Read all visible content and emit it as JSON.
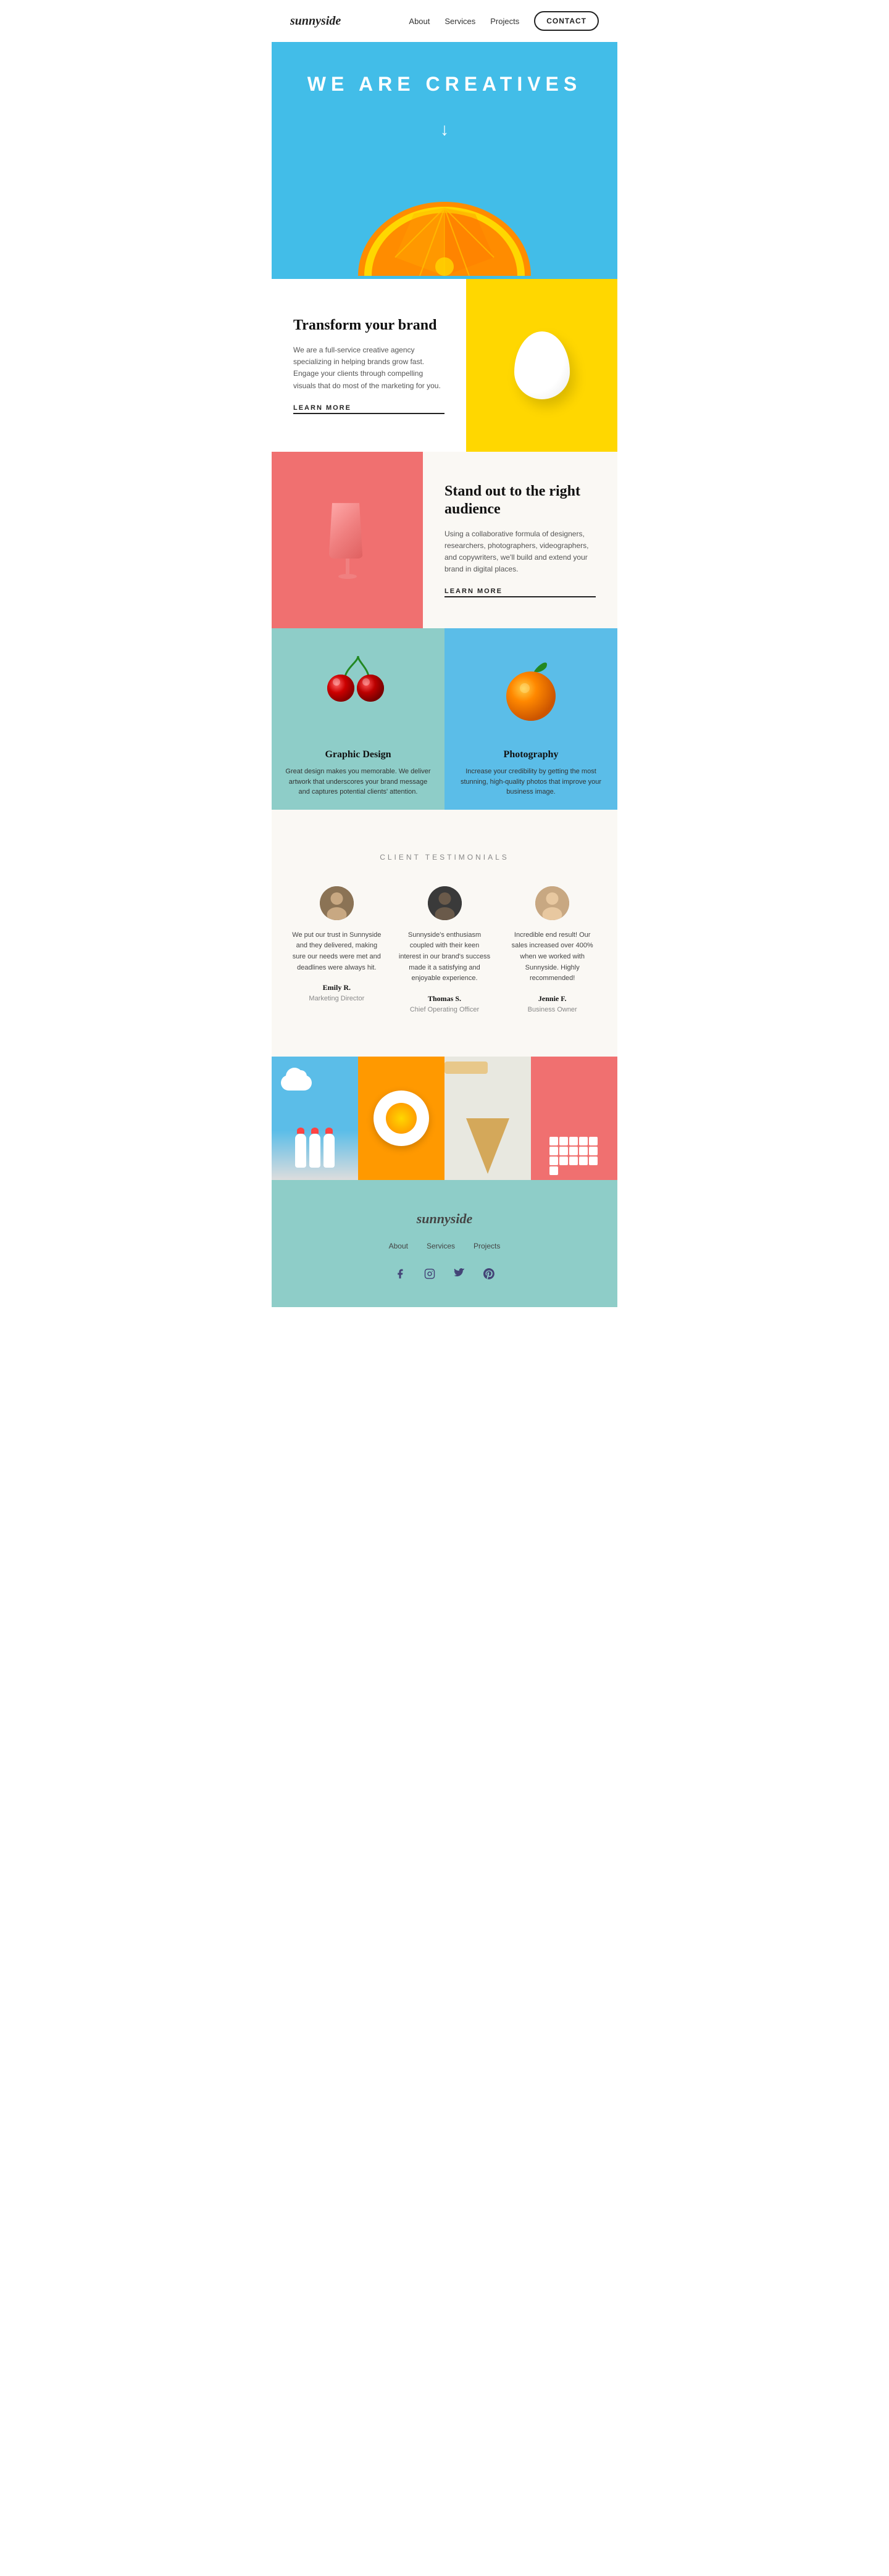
{
  "nav": {
    "logo": "sunnyside",
    "links": [
      {
        "label": "About",
        "href": "#about"
      },
      {
        "label": "Services",
        "href": "#services"
      },
      {
        "label": "Projects",
        "href": "#projects"
      }
    ],
    "contact_label": "CONTACT"
  },
  "hero": {
    "title": "WE ARE CREATIVES",
    "arrow": "↓"
  },
  "transform": {
    "heading": "Transform your brand",
    "body": "We are a full-service creative agency specializing in helping brands grow fast. Engage your clients through compelling visuals that do most of the marketing for you.",
    "cta": "LEARN MORE"
  },
  "standout": {
    "heading": "Stand out to the right audience",
    "body": "Using a collaborative formula of designers, researchers, photographers, videographers, and copywriters, we'll build and extend your brand in digital places.",
    "cta": "LEARN MORE"
  },
  "services": [
    {
      "title": "Graphic Design",
      "body": "Great design makes you memorable. We deliver artwork that underscores your brand message and captures potential clients' attention."
    },
    {
      "title": "Photography",
      "body": "Increase your credibility by getting the most stunning, high-quality photos that improve your business image."
    }
  ],
  "testimonials": {
    "section_title": "CLIENT TESTIMONIALS",
    "items": [
      {
        "quote": "We put our trust in Sunnyside and they delivered, making sure our needs were met and deadlines were always hit.",
        "name": "Emily R.",
        "role": "Marketing Director"
      },
      {
        "quote": "Sunnyside's enthusiasm coupled with their keen interest in our brand's success made it a satisfying and enjoyable experience.",
        "name": "Thomas S.",
        "role": "Chief Operating Officer"
      },
      {
        "quote": "Incredible end result! Our sales increased over 400% when we worked with Sunnyside. Highly recommended!",
        "name": "Jennie F.",
        "role": "Business Owner"
      }
    ]
  },
  "footer": {
    "logo": "sunnyside",
    "nav": [
      {
        "label": "About"
      },
      {
        "label": "Services"
      },
      {
        "label": "Projects"
      }
    ],
    "social": [
      "facebook",
      "instagram",
      "twitter",
      "pinterest"
    ]
  }
}
